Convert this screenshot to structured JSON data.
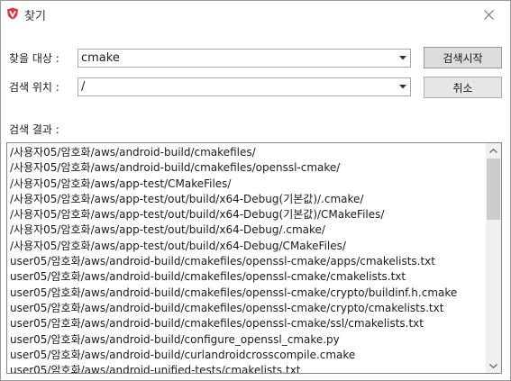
{
  "window": {
    "title": "찾기",
    "app_icon": "shield-v-logo-icon",
    "close_icon": "close-icon",
    "accent_color": "#d9363e"
  },
  "form": {
    "target_label": "찾을 대상 :",
    "target_value": "cmake",
    "location_label": "검색 위치 :",
    "location_value": "/",
    "start_button": "검색시작",
    "cancel_button": "취소",
    "results_label": "검색 결과 :"
  },
  "results": [
    "/사용자05/암호화/aws/android-build/cmakefiles/",
    "/사용자05/암호화/aws/android-build/cmakefiles/openssl-cmake/",
    "/사용자05/암호화/aws/app-test/CMakeFiles/",
    "/사용자05/암호화/aws/app-test/out/build/x64-Debug(기본값)/.cmake/",
    "/사용자05/암호화/aws/app-test/out/build/x64-Debug(기본값)/CMakeFiles/",
    "/사용자05/암호화/aws/app-test/out/build/x64-Debug/.cmake/",
    "/사용자05/암호화/aws/app-test/out/build/x64-Debug/CMakeFiles/",
    "user05/암호화/aws/android-build/cmakefiles/openssl-cmake/apps/cmakelists.txt",
    "user05/암호화/aws/android-build/cmakefiles/openssl-cmake/cmakelists.txt",
    "user05/암호화/aws/android-build/cmakefiles/openssl-cmake/crypto/buildinf.h.cmake",
    "user05/암호화/aws/android-build/cmakefiles/openssl-cmake/crypto/cmakelists.txt",
    "user05/암호화/aws/android-build/cmakefiles/openssl-cmake/ssl/cmakelists.txt",
    "user05/암호화/aws/android-build/configure_openssl_cmake.py",
    "user05/암호화/aws/android-build/curlandroidcrosscompile.cmake",
    "user05/암호화/aws/android-unified-tests/cmakelists.txt"
  ]
}
